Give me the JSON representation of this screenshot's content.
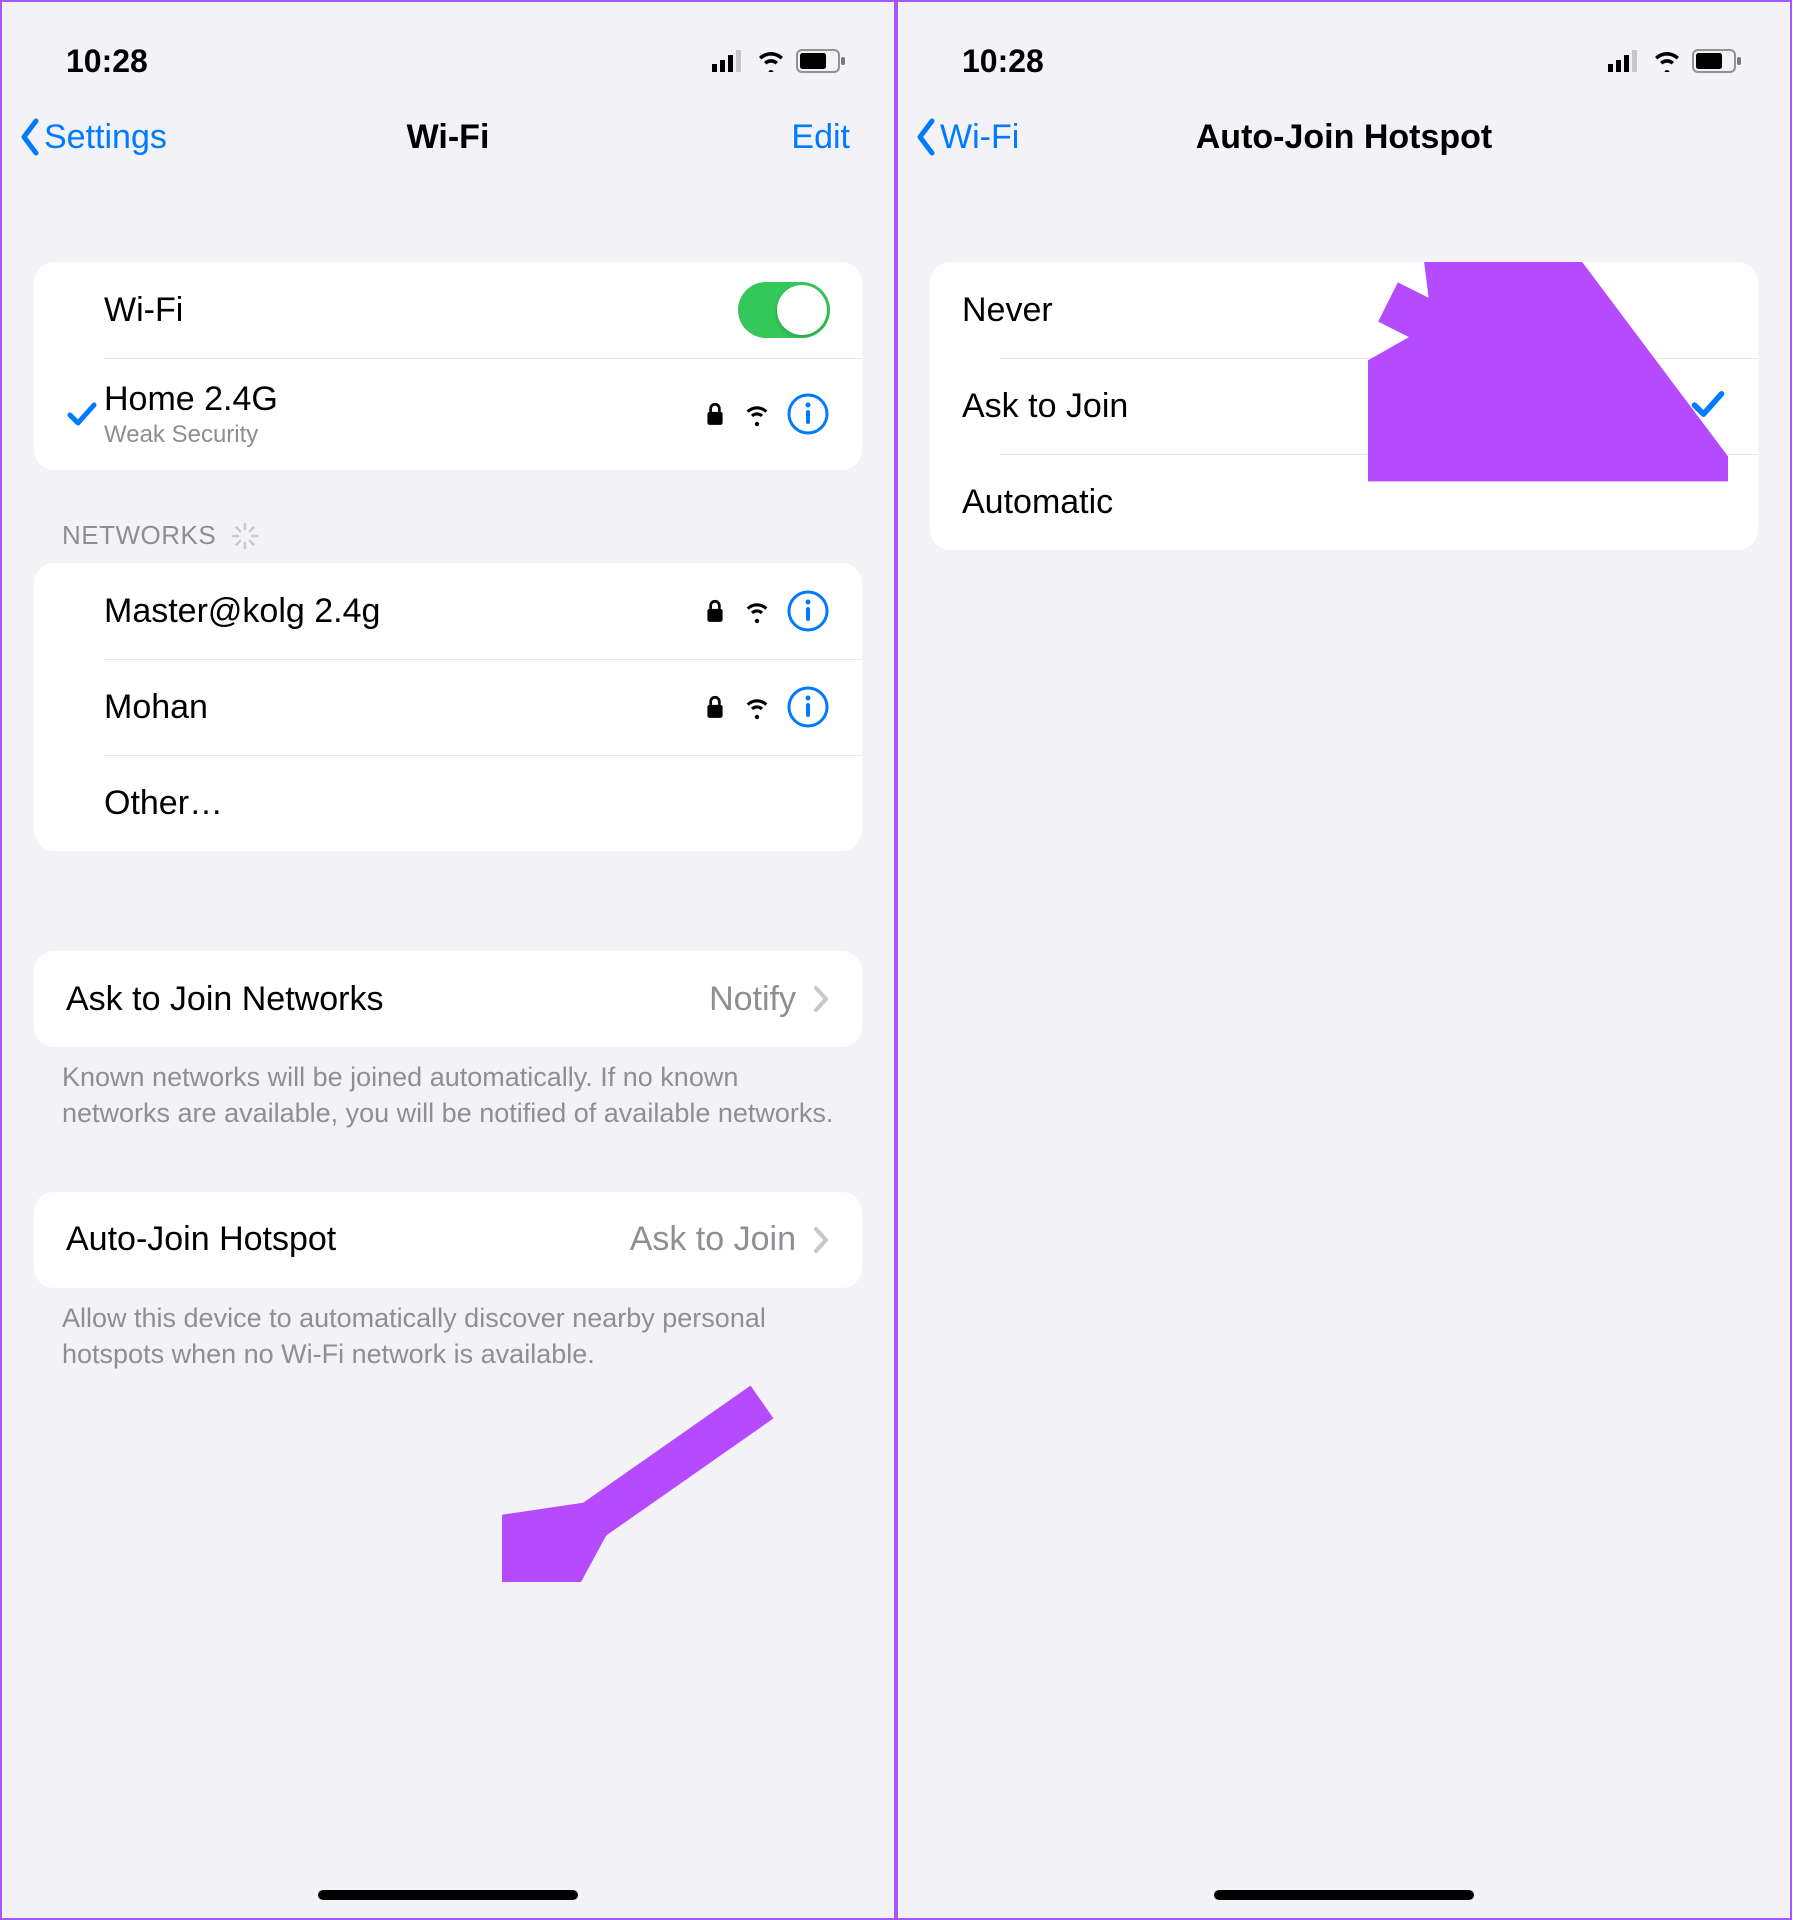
{
  "left": {
    "status": {
      "time": "10:28"
    },
    "nav": {
      "back": "Settings",
      "title": "Wi-Fi",
      "edit": "Edit"
    },
    "wifi_toggle": {
      "label": "Wi-Fi",
      "on": true
    },
    "connected": {
      "name": "Home 2.4G",
      "subtitle": "Weak Security"
    },
    "networks_header": "NETWORKS",
    "networks": [
      {
        "name": "Master@kolg 2.4g"
      },
      {
        "name": "Mohan"
      },
      {
        "name": "Other…"
      }
    ],
    "ask_join": {
      "label": "Ask to Join Networks",
      "value": "Notify"
    },
    "ask_join_footer": "Known networks will be joined automatically. If no known networks are available, you will be notified of available networks.",
    "auto_join": {
      "label": "Auto-Join Hotspot",
      "value": "Ask to Join"
    },
    "auto_join_footer": "Allow this device to automatically discover nearby personal hotspots when no Wi-Fi network is available."
  },
  "right": {
    "status": {
      "time": "10:28"
    },
    "nav": {
      "back": "Wi-Fi",
      "title": "Auto-Join Hotspot"
    },
    "options": [
      {
        "label": "Never",
        "selected": false
      },
      {
        "label": "Ask to Join",
        "selected": true
      },
      {
        "label": "Automatic",
        "selected": false
      }
    ]
  }
}
